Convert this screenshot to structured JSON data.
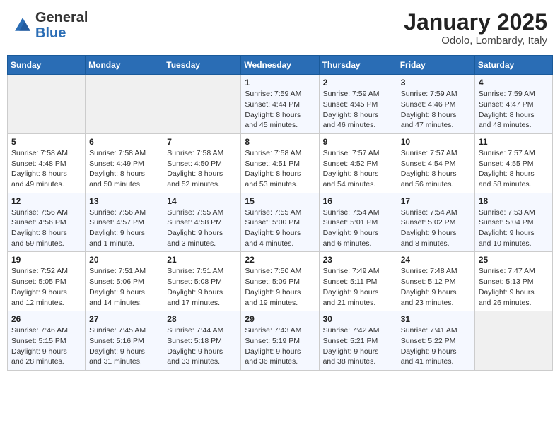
{
  "header": {
    "logo": {
      "general": "General",
      "blue": "Blue"
    },
    "title": "January 2025",
    "location": "Odolo, Lombardy, Italy"
  },
  "weekdays": [
    "Sunday",
    "Monday",
    "Tuesday",
    "Wednesday",
    "Thursday",
    "Friday",
    "Saturday"
  ],
  "weeks": [
    [
      {
        "day": "",
        "info": ""
      },
      {
        "day": "",
        "info": ""
      },
      {
        "day": "",
        "info": ""
      },
      {
        "day": "1",
        "info": "Sunrise: 7:59 AM\nSunset: 4:44 PM\nDaylight: 8 hours\nand 45 minutes."
      },
      {
        "day": "2",
        "info": "Sunrise: 7:59 AM\nSunset: 4:45 PM\nDaylight: 8 hours\nand 46 minutes."
      },
      {
        "day": "3",
        "info": "Sunrise: 7:59 AM\nSunset: 4:46 PM\nDaylight: 8 hours\nand 47 minutes."
      },
      {
        "day": "4",
        "info": "Sunrise: 7:59 AM\nSunset: 4:47 PM\nDaylight: 8 hours\nand 48 minutes."
      }
    ],
    [
      {
        "day": "5",
        "info": "Sunrise: 7:58 AM\nSunset: 4:48 PM\nDaylight: 8 hours\nand 49 minutes."
      },
      {
        "day": "6",
        "info": "Sunrise: 7:58 AM\nSunset: 4:49 PM\nDaylight: 8 hours\nand 50 minutes."
      },
      {
        "day": "7",
        "info": "Sunrise: 7:58 AM\nSunset: 4:50 PM\nDaylight: 8 hours\nand 52 minutes."
      },
      {
        "day": "8",
        "info": "Sunrise: 7:58 AM\nSunset: 4:51 PM\nDaylight: 8 hours\nand 53 minutes."
      },
      {
        "day": "9",
        "info": "Sunrise: 7:57 AM\nSunset: 4:52 PM\nDaylight: 8 hours\nand 54 minutes."
      },
      {
        "day": "10",
        "info": "Sunrise: 7:57 AM\nSunset: 4:54 PM\nDaylight: 8 hours\nand 56 minutes."
      },
      {
        "day": "11",
        "info": "Sunrise: 7:57 AM\nSunset: 4:55 PM\nDaylight: 8 hours\nand 58 minutes."
      }
    ],
    [
      {
        "day": "12",
        "info": "Sunrise: 7:56 AM\nSunset: 4:56 PM\nDaylight: 8 hours\nand 59 minutes."
      },
      {
        "day": "13",
        "info": "Sunrise: 7:56 AM\nSunset: 4:57 PM\nDaylight: 9 hours\nand 1 minute."
      },
      {
        "day": "14",
        "info": "Sunrise: 7:55 AM\nSunset: 4:58 PM\nDaylight: 9 hours\nand 3 minutes."
      },
      {
        "day": "15",
        "info": "Sunrise: 7:55 AM\nSunset: 5:00 PM\nDaylight: 9 hours\nand 4 minutes."
      },
      {
        "day": "16",
        "info": "Sunrise: 7:54 AM\nSunset: 5:01 PM\nDaylight: 9 hours\nand 6 minutes."
      },
      {
        "day": "17",
        "info": "Sunrise: 7:54 AM\nSunset: 5:02 PM\nDaylight: 9 hours\nand 8 minutes."
      },
      {
        "day": "18",
        "info": "Sunrise: 7:53 AM\nSunset: 5:04 PM\nDaylight: 9 hours\nand 10 minutes."
      }
    ],
    [
      {
        "day": "19",
        "info": "Sunrise: 7:52 AM\nSunset: 5:05 PM\nDaylight: 9 hours\nand 12 minutes."
      },
      {
        "day": "20",
        "info": "Sunrise: 7:51 AM\nSunset: 5:06 PM\nDaylight: 9 hours\nand 14 minutes."
      },
      {
        "day": "21",
        "info": "Sunrise: 7:51 AM\nSunset: 5:08 PM\nDaylight: 9 hours\nand 17 minutes."
      },
      {
        "day": "22",
        "info": "Sunrise: 7:50 AM\nSunset: 5:09 PM\nDaylight: 9 hours\nand 19 minutes."
      },
      {
        "day": "23",
        "info": "Sunrise: 7:49 AM\nSunset: 5:11 PM\nDaylight: 9 hours\nand 21 minutes."
      },
      {
        "day": "24",
        "info": "Sunrise: 7:48 AM\nSunset: 5:12 PM\nDaylight: 9 hours\nand 23 minutes."
      },
      {
        "day": "25",
        "info": "Sunrise: 7:47 AM\nSunset: 5:13 PM\nDaylight: 9 hours\nand 26 minutes."
      }
    ],
    [
      {
        "day": "26",
        "info": "Sunrise: 7:46 AM\nSunset: 5:15 PM\nDaylight: 9 hours\nand 28 minutes."
      },
      {
        "day": "27",
        "info": "Sunrise: 7:45 AM\nSunset: 5:16 PM\nDaylight: 9 hours\nand 31 minutes."
      },
      {
        "day": "28",
        "info": "Sunrise: 7:44 AM\nSunset: 5:18 PM\nDaylight: 9 hours\nand 33 minutes."
      },
      {
        "day": "29",
        "info": "Sunrise: 7:43 AM\nSunset: 5:19 PM\nDaylight: 9 hours\nand 36 minutes."
      },
      {
        "day": "30",
        "info": "Sunrise: 7:42 AM\nSunset: 5:21 PM\nDaylight: 9 hours\nand 38 minutes."
      },
      {
        "day": "31",
        "info": "Sunrise: 7:41 AM\nSunset: 5:22 PM\nDaylight: 9 hours\nand 41 minutes."
      },
      {
        "day": "",
        "info": ""
      }
    ]
  ]
}
